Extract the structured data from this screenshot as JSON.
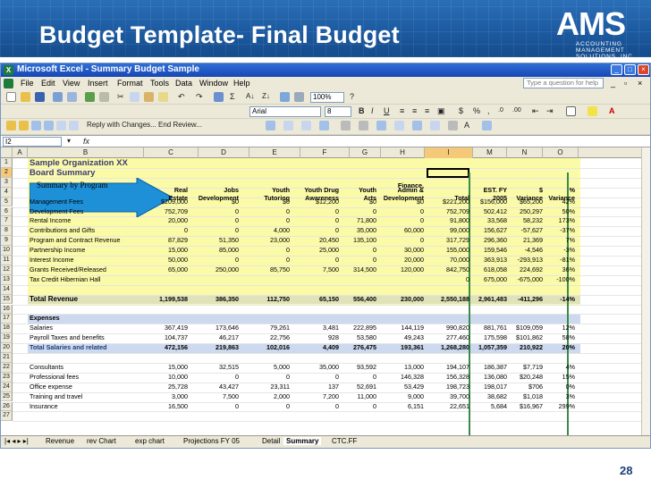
{
  "slide": {
    "title": "Budget Template- Final Budget",
    "page_number": "28"
  },
  "logo": {
    "name": "AMS",
    "tagline": "ACCOUNTING\nMANAGEMENT\nSOLUTIONS, INC."
  },
  "window": {
    "title": "Microsoft Excel - Summary Budget Sample"
  },
  "menu": [
    "File",
    "Edit",
    "View",
    "Insert",
    "Format",
    "Tools",
    "Data",
    "Window",
    "Help"
  ],
  "help_placeholder": "Type a question for help",
  "toolbar": {
    "zoom": "100%",
    "font": "Arial",
    "size": "8",
    "reply_text": "Reply with Changes...",
    "end_review": "End Review..."
  },
  "name_box": "I2",
  "columns": [
    "A",
    "B",
    "C",
    "D",
    "E",
    "F",
    "G",
    "H",
    "I",
    "M",
    "N",
    "O"
  ],
  "rows": [
    "1",
    "2",
    "3",
    "4",
    "5",
    "6",
    "7",
    "8",
    "9",
    "10",
    "11",
    "12",
    "13",
    "14",
    "15",
    "16",
    "17",
    "18",
    "19",
    "20",
    "21",
    "22",
    "23",
    "24",
    "25",
    "26",
    "27"
  ],
  "sheet": {
    "title1": "Sample Organization XX",
    "title2": "Board Summary",
    "arrow_label": "Summary by Program",
    "col_headers_top": [
      "",
      "",
      "",
      "",
      "Finance,",
      "",
      "",
      "",
      ""
    ],
    "col_headers_mid": [
      "Real",
      "Jobs",
      "Youth",
      "Youth Drug",
      "Youth",
      "Admin &",
      "",
      "EST. FY",
      "$",
      "%"
    ],
    "col_headers_bot": [
      "Estate",
      "Development",
      "Tutoring",
      "Awareness",
      "Arts",
      "Development",
      "Total",
      "2005",
      "Variance",
      "Variance"
    ],
    "revenue_rows": [
      {
        "label": "Management Fees",
        "v": [
          "$209,000",
          "$0",
          "$0",
          "$12,200",
          "$0",
          "$0",
          "$221,200",
          "$156,000",
          "$65,200",
          "42%"
        ]
      },
      {
        "label": "Development Fees",
        "v": [
          "752,709",
          "0",
          "0",
          "0",
          "0",
          "0",
          "752,709",
          "502,412",
          "250,297",
          "50%"
        ]
      },
      {
        "label": "Rental Income",
        "v": [
          "20,000",
          "0",
          "0",
          "0",
          "71,800",
          "0",
          "91,800",
          "33,568",
          "58,232",
          "173%"
        ]
      },
      {
        "label": "Contributions and Gifts",
        "v": [
          "0",
          "0",
          "4,000",
          "0",
          "35,000",
          "60,000",
          "99,000",
          "156,627",
          "-57,627",
          "-37%"
        ]
      },
      {
        "label": "Program and Contract Revenue",
        "v": [
          "87,829",
          "51,350",
          "23,000",
          "20,450",
          "135,100",
          "0",
          "317,729",
          "296,360",
          "21,369",
          "7%"
        ]
      },
      {
        "label": "Partnership Income",
        "v": [
          "15,000",
          "85,000",
          "0",
          "25,000",
          "0",
          "30,000",
          "155,000",
          "159,546",
          "-4,546",
          "-3%"
        ]
      },
      {
        "label": "Interest Income",
        "v": [
          "50,000",
          "0",
          "0",
          "0",
          "0",
          "20,000",
          "70,000",
          "363,913",
          "-293,913",
          "-81%"
        ]
      },
      {
        "label": "Grants Received/Released",
        "v": [
          "65,000",
          "250,000",
          "85,750",
          "7,500",
          "314,500",
          "120,000",
          "842,750",
          "618,058",
          "224,692",
          "36%"
        ]
      },
      {
        "label": "Tax Credit Hibernian Hall",
        "v": [
          "",
          "",
          "",
          "",
          "",
          "",
          "0",
          "675,000",
          "-675,000",
          "-100%"
        ]
      }
    ],
    "total_revenue": {
      "label": "Total Revenue",
      "v": [
        "1,199,538",
        "386,350",
        "112,750",
        "65,150",
        "556,400",
        "230,000",
        "2,550,188",
        "2,961,483",
        "-411,296",
        "-14%"
      ]
    },
    "expenses_label": "Expenses",
    "expense_rows": [
      {
        "label": "Salaries",
        "v": [
          "367,419",
          "173,646",
          "79,261",
          "3,481",
          "222,895",
          "144,119",
          "990,820",
          "881,761",
          "$109,059",
          "12%"
        ]
      },
      {
        "label": "Payroll Taxes and benefits",
        "v": [
          "104,737",
          "46,217",
          "22,756",
          "928",
          "53,580",
          "49,243",
          "277,460",
          "175,598",
          "$101,862",
          "58%"
        ]
      }
    ],
    "total_salaries": {
      "label": "Total Salaries and related",
      "v": [
        "472,156",
        "219,863",
        "102,016",
        "4,409",
        "276,475",
        "193,361",
        "1,268,280",
        "1,057,359",
        "210,922",
        "20%"
      ]
    },
    "other_rows": [
      {
        "label": "Consultants",
        "v": [
          "15,000",
          "32,515",
          "5,000",
          "35,000",
          "93,592",
          "13,000",
          "194,107",
          "186,387",
          "$7,719",
          "4%"
        ]
      },
      {
        "label": "Professional fees",
        "v": [
          "10,000",
          "0",
          "0",
          "0",
          "0",
          "146,328",
          "156,328",
          "136,080",
          "$20,248",
          "15%"
        ]
      },
      {
        "label": "Office expense",
        "v": [
          "25,728",
          "43,427",
          "23,311",
          "137",
          "52,691",
          "53,429",
          "198,723",
          "198,017",
          "$706",
          "0%"
        ]
      },
      {
        "label": "Training and travel",
        "v": [
          "3,000",
          "7,500",
          "2,000",
          "7,200",
          "11,000",
          "9,000",
          "39,700",
          "38,682",
          "$1,018",
          "3%"
        ]
      },
      {
        "label": "Insurance",
        "v": [
          "16,500",
          "0",
          "0",
          "0",
          "0",
          "6,151",
          "22,651",
          "5,684",
          "$16,967",
          "299%"
        ]
      }
    ]
  },
  "sheet_tabs": [
    "Revenue",
    "rev Chart",
    "exp chart",
    "Projections FY 05",
    "Detail",
    "Summary",
    "CTC.FF"
  ]
}
